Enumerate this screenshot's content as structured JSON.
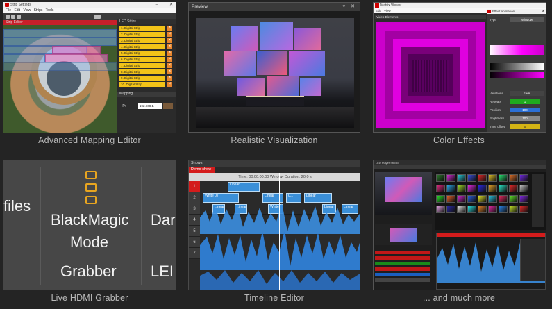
{
  "tiles": {
    "mapping": {
      "caption": "Advanced Mapping Editor",
      "window_title": "Strip Settings",
      "menu": "File  Edit  View  Strips  Tools",
      "strip_editor_label": "Strip Editor",
      "led_strips_label": "LED Strips",
      "strips": [
        "1. Digital Strip",
        "2. Digital Strip",
        "3. Digital Strip",
        "4. Digital Strip",
        "5. Digital Strip",
        "6. Digital Strip",
        "7. Digital Strip",
        "8. Digital Strip",
        "9. Digital Strip",
        "10. Digital Strip"
      ],
      "mapping_label": "Mapping",
      "ip_label": "IP: 192.168.1.",
      "ip_value": "192.168.1."
    },
    "preview": {
      "caption": "Realistic Visualization",
      "panel_title": "Preview"
    },
    "color_effects": {
      "caption": "Color Effects",
      "window_title": "Matrix Viewer",
      "menu": "Edit  View",
      "video_elements_label": "Video Elements",
      "effect_window_title": "Effect animation",
      "tab_label": "Window",
      "rows": [
        {
          "label": "Type",
          "value": "Window"
        },
        {
          "label": "Variations",
          "value": "Fade"
        },
        {
          "label": "Repeats",
          "value": "1"
        },
        {
          "label": "Position",
          "value": "100"
        },
        {
          "label": "Brightness",
          "value": "100"
        },
        {
          "label": "Time offset",
          "value": "0"
        }
      ],
      "accent_magenta": "#cc00cc"
    },
    "hdmi": {
      "caption": "Live HDMI Grabber",
      "left_word": "files",
      "title_line1": "BlackMagic",
      "title_line2": "Mode",
      "title_line3": "Grabber",
      "right_line1": "Dar",
      "right_line3": "LEI",
      "icon_color": "#e8a520"
    },
    "timeline": {
      "caption": "Timeline Editor",
      "panel_title": "Shows",
      "tab_label": "Demo show",
      "ruler_text": "Time: 00:00:00:00    Window Duration: 20.0 s",
      "track_numbers": [
        "1",
        "2",
        "3",
        "4",
        "5",
        "6",
        "7"
      ],
      "clips": [
        "Linear",
        "White 07",
        "Linear",
        "0.1",
        "0.1",
        "Linear",
        "White",
        "Linear",
        "Linear",
        "Linear",
        "Linear",
        "Linear"
      ],
      "clip_color": "#3a8fd8",
      "tab_color": "#d41c1c"
    },
    "more": {
      "caption": "... and much more",
      "title_text": "LED Player Studio"
    }
  }
}
